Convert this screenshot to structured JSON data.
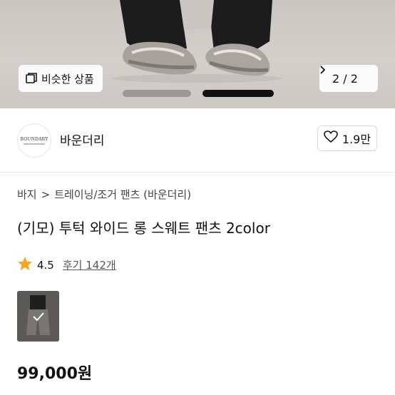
{
  "hero": {
    "similar_label": "비슷한 상품",
    "page_current": "2",
    "page_separator": "/",
    "page_total": "2"
  },
  "brand": {
    "name": "바운더리",
    "logo_text": "BOUNDARY",
    "likes": "1.9만"
  },
  "breadcrumb": [
    "바지",
    "트레이닝/조거 팬츠 (바운더리)"
  ],
  "product": {
    "title": "(기모) 투턱 와이드 롱 스웨트 팬츠 2color",
    "rating": "4.5",
    "reviews": "후기 142개",
    "price": "99,000원"
  },
  "colors": {
    "star": "#f5a623",
    "text": "#111111",
    "indicator_active": "#111111",
    "indicator_inactive": "#9b9895"
  }
}
